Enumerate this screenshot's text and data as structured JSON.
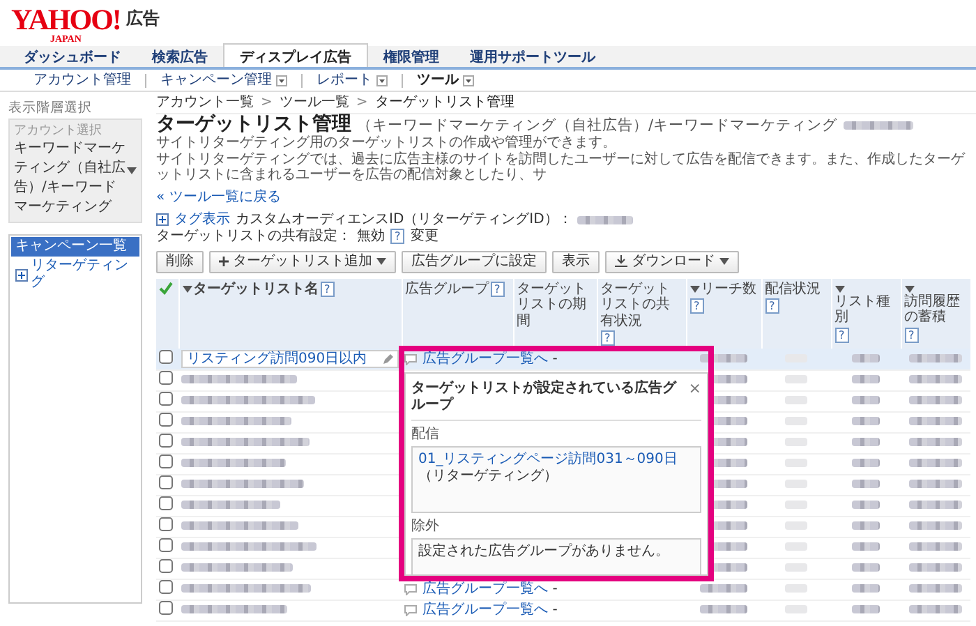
{
  "logo": {
    "brand": "YAHOO!",
    "sub": "JAPAN",
    "product": "広告"
  },
  "tabs": [
    {
      "label": "ダッシュボード",
      "selected": false
    },
    {
      "label": "検索広告",
      "selected": false
    },
    {
      "label": "ディスプレイ広告",
      "selected": true
    },
    {
      "label": "権限管理",
      "selected": false
    },
    {
      "label": "運用サポートツール",
      "selected": false
    }
  ],
  "subnav": [
    {
      "label": "アカウント管理",
      "dropdown": false,
      "selected": false
    },
    {
      "label": "キャンペーン管理",
      "dropdown": true,
      "selected": false
    },
    {
      "label": "レポート",
      "dropdown": true,
      "selected": false
    },
    {
      "label": "ツール",
      "dropdown": true,
      "selected": true
    }
  ],
  "sidebar": {
    "heading": "表示階層選択",
    "account_label": "アカウント選択",
    "account": "キーワードマーケティング（自社広告）/キーワードマーケティング",
    "items": [
      {
        "label": "キャンペーン一覧",
        "kind": "header",
        "selected": true
      },
      {
        "label": "リターゲティング",
        "kind": "campaign",
        "selected": false
      }
    ]
  },
  "breadcrumb": [
    {
      "label": "アカウント一覧",
      "kind": "link"
    },
    {
      "label": ">",
      "kind": "separator"
    },
    {
      "label": "ツール一覧",
      "kind": "link"
    },
    {
      "label": ">",
      "kind": "separator"
    },
    {
      "label": "ターゲットリスト管理",
      "kind": "current"
    }
  ],
  "page": {
    "title": "ターゲットリスト管理",
    "subtitle": "（キーワードマーケティング（自社広告）/キーワードマーケティング",
    "description": [
      "サイトリターゲティング用のターゲットリストの作成や管理ができます。",
      "サイトリターゲティングでは、過去に広告主様のサイトを訪問したユーザーに対して広告を配信できます。また、作成したターゲットリストに含まれるユーザーを広告の配信対象としたり、サ"
    ],
    "back_link": "« ツール一覧に戻る",
    "tag_toggle": "タグ表示",
    "audience_label": "カスタムオーディエンスID（リターゲティングID）：",
    "share_label": "ターゲットリストの共有設定：",
    "share_value": "無効",
    "share_help": "?",
    "share_change": "変更"
  },
  "toolbar": [
    {
      "label": "削除",
      "kind": "plain"
    },
    {
      "label": "ターゲットリスト追加",
      "kind": "add"
    },
    {
      "label": "広告グループに設定",
      "kind": "plain"
    },
    {
      "label": "表示",
      "kind": "plain"
    },
    {
      "label": "ダウンロード",
      "kind": "download"
    }
  ],
  "table": {
    "columns": [
      {
        "label": "ターゲットリスト名",
        "help": "?",
        "sortable": true
      },
      {
        "label": "広告グループ",
        "help": "?",
        "sortable": false
      },
      {
        "label": "ターゲットリストの期間",
        "sortable": false
      },
      {
        "label": "ターゲットリストの共有状況",
        "help": "?",
        "sortable": false
      },
      {
        "label": "リーチ数",
        "help": "?",
        "sortable": true
      },
      {
        "label": "配信状況",
        "help": "?",
        "sortable": false
      },
      {
        "label": "リスト種別",
        "help": "?",
        "sortable": true
      },
      {
        "label": "訪問履歴の蓄積",
        "help": "?",
        "sortable": true
      }
    ],
    "rows": [
      {
        "kind": "editing",
        "name": "リスティング訪問090日以内",
        "checked": false,
        "ad_group": "広告グループ一覧へ",
        "period": "-"
      },
      {
        "kind": "blurred",
        "checked": false
      },
      {
        "kind": "blurred",
        "checked": false
      },
      {
        "kind": "blurred",
        "checked": false
      },
      {
        "kind": "blurred",
        "checked": false
      },
      {
        "kind": "blurred",
        "checked": false
      },
      {
        "kind": "blurred",
        "checked": false
      },
      {
        "kind": "blurred",
        "checked": false
      },
      {
        "kind": "blurred",
        "checked": false
      },
      {
        "kind": "blurred",
        "checked": false
      },
      {
        "kind": "blurred",
        "checked": false
      },
      {
        "kind": "blurred",
        "checked": false,
        "ad_group": "広告グループ一覧へ",
        "period": "-"
      },
      {
        "kind": "blurred",
        "checked": false,
        "ad_group": "広告グループ一覧へ",
        "period": "-"
      }
    ]
  },
  "popup": {
    "title": "ターゲットリストが設定されている広告グループ",
    "close": "×",
    "sections": [
      {
        "label": "配信",
        "kind": "list",
        "entries": [
          {
            "name": "01_リスティングページ訪問031～090日",
            "type": "（リターゲティング）"
          }
        ]
      },
      {
        "label": "除外",
        "kind": "empty",
        "message": "設定された広告グループがありません。"
      }
    ]
  }
}
